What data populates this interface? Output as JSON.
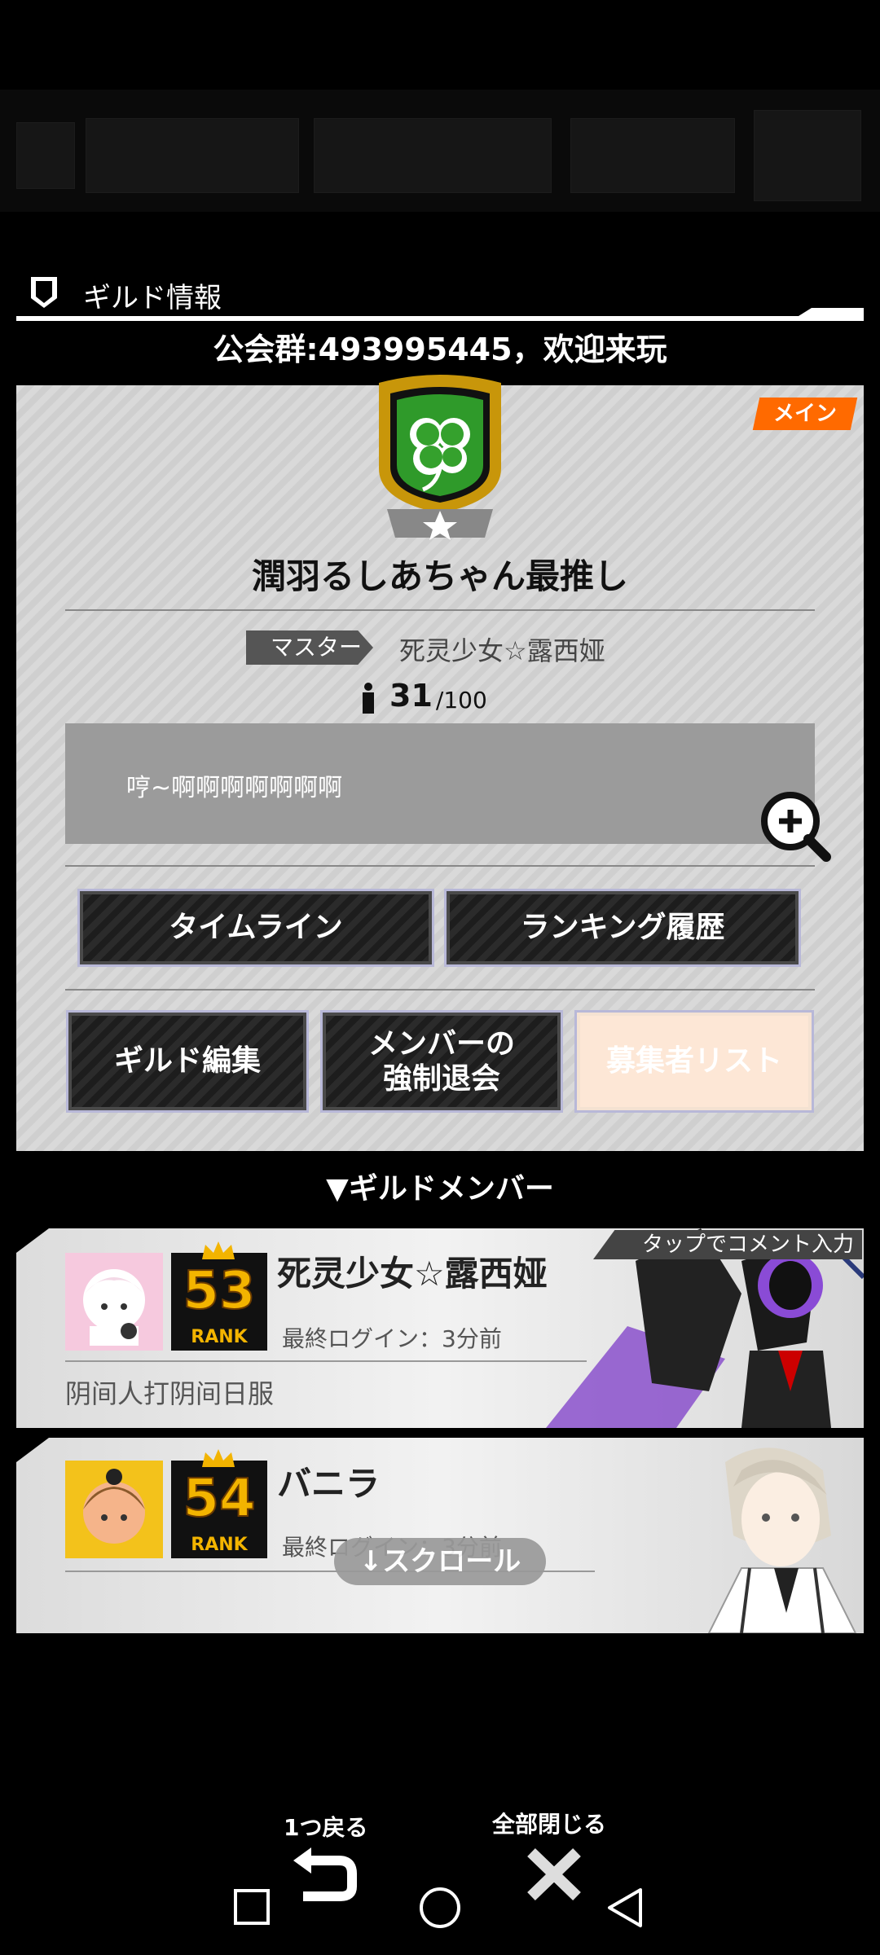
{
  "header": {
    "title": "ギルド情報",
    "notice": "公会群:493995445，欢迎来玩"
  },
  "guild": {
    "badge": "メイン",
    "name": "潤羽るしあちゃん最推し",
    "master_label": "マスター",
    "master_name": "死灵少女☆露西娅",
    "member_count": "31",
    "member_max": "/100",
    "description": "哼~啊啊啊啊啊啊啊"
  },
  "buttons": {
    "timeline": "タイムライン",
    "ranking_history": "ランキング履歴",
    "guild_edit": "ギルド編集",
    "kick_member": "メンバーの\n強制退会",
    "applicant_list": "募集者リスト"
  },
  "members_header": "▼ギルドメンバー",
  "members": [
    {
      "name": "死灵少女☆露西娅",
      "rank": "53",
      "rank_label": "RANK",
      "last_login": "最終ログイン：3分前",
      "comment": "阴间人打阴间日服",
      "tap_hint": "タップでコメント入力"
    },
    {
      "name": "バニラ",
      "rank": "54",
      "rank_label": "RANK",
      "last_login": "最終ログイン：3分前",
      "comment": ""
    }
  ],
  "scroll_hint": "↓スクロール",
  "bottom": {
    "back": "1つ戻る",
    "close_all": "全部閉じる"
  },
  "colors": {
    "accent": "#ff6a00",
    "emblem_green": "#3ea832",
    "emblem_gold": "#c8960a"
  }
}
